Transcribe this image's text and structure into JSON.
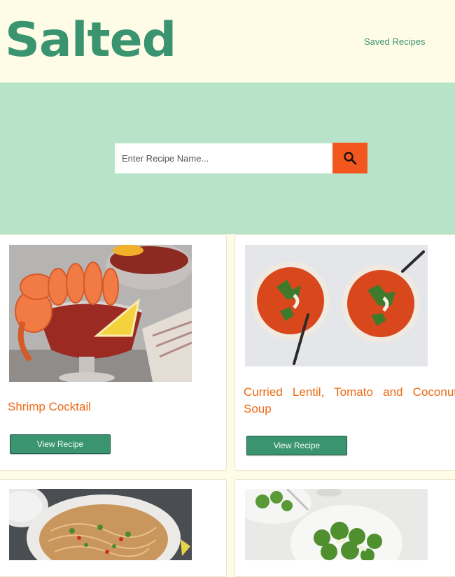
{
  "header": {
    "logo": "Salted",
    "nav_saved": "Saved Recipes"
  },
  "search": {
    "placeholder": "Enter Recipe Name...",
    "icon": "search-icon"
  },
  "recipes": [
    {
      "title": "Shrimp Cocktail",
      "button": "View Recipe",
      "image": "shrimp-cocktail-photo"
    },
    {
      "title": "Curried Lentil, Tomato and Coconut Soup",
      "button": "View Recipe",
      "image": "lentil-soup-photo"
    },
    {
      "title": "",
      "button": "",
      "image": "noodle-salad-photo"
    },
    {
      "title": "",
      "button": "",
      "image": "green-salad-photo"
    }
  ],
  "colors": {
    "brand": "#3a9470",
    "header_bg": "#fefbe6",
    "hero_bg": "#b7e4c9",
    "search_button": "#f4571e",
    "title_text": "#ec6a14"
  }
}
